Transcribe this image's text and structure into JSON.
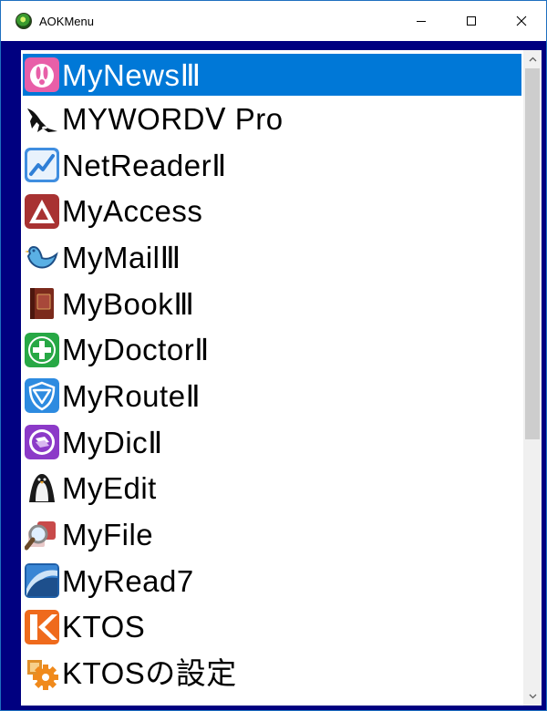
{
  "window": {
    "title": "AOKMenu",
    "controls": {
      "minimize": "minimize-icon",
      "maximize": "maximize-icon",
      "close": "close-icon"
    }
  },
  "list": {
    "selected_index": 0,
    "items": [
      {
        "label": "MyNewsⅢ",
        "icon": "bunny-icon"
      },
      {
        "label": "MYWORDⅤ Pro",
        "icon": "orca-icon"
      },
      {
        "label": "NetReaderⅡ",
        "icon": "chart-line-icon"
      },
      {
        "label": "MyAccess",
        "icon": "triangle-a-icon"
      },
      {
        "label": "MyMailⅢ",
        "icon": "bird-icon"
      },
      {
        "label": "MyBookⅢ",
        "icon": "book-icon"
      },
      {
        "label": "MyDoctorⅡ",
        "icon": "medical-cross-icon"
      },
      {
        "label": "MyRouteⅡ",
        "icon": "shield-route-icon"
      },
      {
        "label": "MyDicⅡ",
        "icon": "dictionary-icon"
      },
      {
        "label": "MyEdit",
        "icon": "penguin-icon"
      },
      {
        "label": "MyFile",
        "icon": "magnifier-icon"
      },
      {
        "label": "MyRead7",
        "icon": "wave-icon"
      },
      {
        "label": "KTOS",
        "icon": "k-logo-icon"
      },
      {
        "label": "KTOSの設定",
        "icon": "settings-gear-icon"
      }
    ]
  },
  "scrollbar": {
    "up": "chevron-up-icon",
    "down": "chevron-down-icon",
    "scroll_fraction": 0.0,
    "visible_fraction": 0.6
  },
  "colors": {
    "frame": "#000080",
    "selection": "#0078d7",
    "scroll_track": "#f0f0f0",
    "scroll_thumb": "#cdcdcd"
  }
}
